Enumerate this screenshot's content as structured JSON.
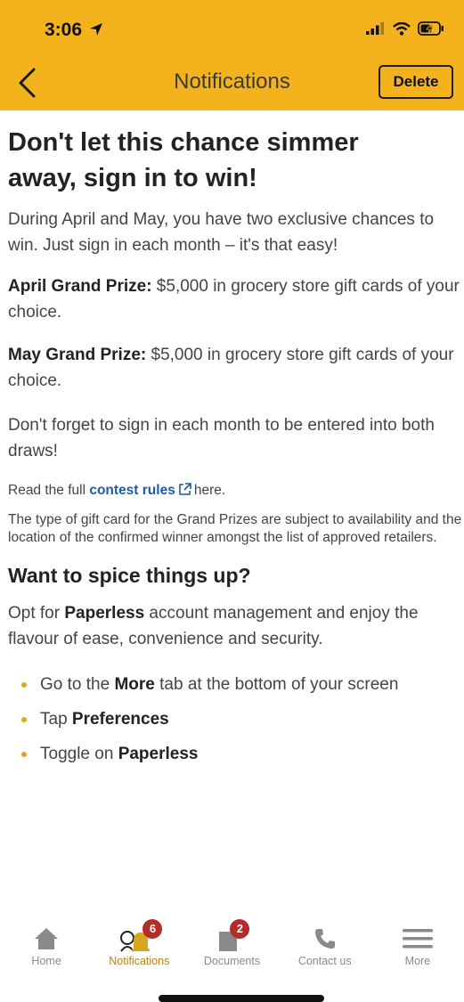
{
  "status_bar": {
    "time": "3:06"
  },
  "header": {
    "title": "Notifications",
    "delete_label": "Delete"
  },
  "article": {
    "title_line1": "Don't let this chance simmer",
    "title_line2": "away, sign in to win!",
    "intro": "During April and May, you have two exclusive chances to win. Just sign in each month – it's that easy!",
    "april_label": "April Grand Prize:",
    "april_text": " $5,000 in grocery store gift cards of your choice.",
    "may_label": "May Grand Prize:",
    "may_text": " $5,000 in grocery store gift cards of your choice.",
    "reminder": "Don't forget to sign in each month to be entered into both draws!",
    "rules_prefix": "Read the full ",
    "rules_link": "contest rules",
    "rules_suffix": "here.",
    "disclaimer": "The type of gift card for the Grand Prizes are subject to availability and the location of the confirmed winner amongst the list of approved retailers.",
    "section2_title": "Want to spice things up?",
    "opt_prefix": "Opt for ",
    "opt_bold": "Paperless",
    "opt_suffix": " account management and enjoy the flavour of ease, convenience and security.",
    "bullets": [
      {
        "prefix": "Go to the ",
        "bold": "More",
        "suffix": " tab at the bottom of your screen"
      },
      {
        "prefix": "Tap ",
        "bold": "Preferences",
        "suffix": ""
      },
      {
        "prefix": "Toggle on ",
        "bold": "Paperless",
        "suffix": ""
      }
    ]
  },
  "tabbar": {
    "home": {
      "label": "Home",
      "icon": "home-icon"
    },
    "notifications": {
      "label": "Notifications",
      "icon": "bell-icon",
      "badge": "6"
    },
    "documents": {
      "label": "Documents",
      "icon": "document-icon",
      "badge": "2"
    },
    "contact": {
      "label": "Contact us",
      "icon": "phone-icon"
    },
    "more": {
      "label": "More",
      "icon": "menu-icon"
    }
  },
  "colors": {
    "accent": "#f4b31c",
    "link": "#1e5ca0",
    "badge": "#b52b27",
    "active_tab": "#b8860b"
  }
}
